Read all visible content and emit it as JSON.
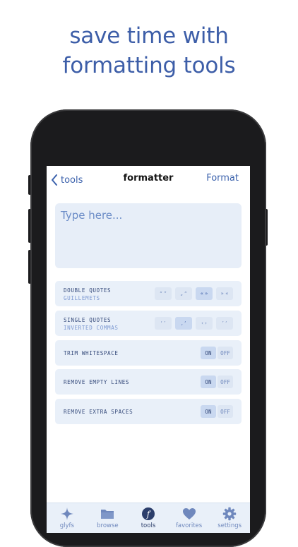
{
  "headline": {
    "line1": "save time with",
    "line2": "formatting tools"
  },
  "colors": {
    "accent": "#3d5ea8",
    "row_bg": "#e9f0f9",
    "selected_bg": "#c9d8f0"
  },
  "navbar": {
    "back_label": "tools",
    "title": "formatter",
    "action_label": "Format"
  },
  "editor": {
    "placeholder": "Type here..."
  },
  "options": {
    "double_quotes": {
      "label": "DOUBLE QUOTES",
      "sublabel": "GUILLEMETS",
      "choices": [
        "“ ”",
        "„ “",
        "« »",
        "» «"
      ],
      "selected_index": 2
    },
    "single_quotes": {
      "label": "SINGLE QUOTES",
      "sublabel": "INVERTED COMMAS",
      "choices": [
        "‘ ’",
        "‚ ‘",
        "‹ ›",
        "’ ‘"
      ],
      "selected_index": 1
    },
    "trim_whitespace": {
      "label": "TRIM WHITESPACE",
      "on": "ON",
      "off": "OFF",
      "value": "ON"
    },
    "remove_empty_lines": {
      "label": "REMOVE EMPTY LINES",
      "on": "ON",
      "off": "OFF",
      "value": "ON"
    },
    "remove_extra_spaces": {
      "label": "REMOVE EXTRA SPACES",
      "on": "ON",
      "off": "OFF",
      "value": "ON"
    }
  },
  "tabbar": {
    "items": [
      {
        "label": "glyfs",
        "icon": "sparkle-icon"
      },
      {
        "label": "browse",
        "icon": "folder-icon"
      },
      {
        "label": "tools",
        "icon": "function-icon"
      },
      {
        "label": "favorites",
        "icon": "heart-icon"
      },
      {
        "label": "settings",
        "icon": "gear-icon"
      }
    ],
    "active": "tools"
  }
}
